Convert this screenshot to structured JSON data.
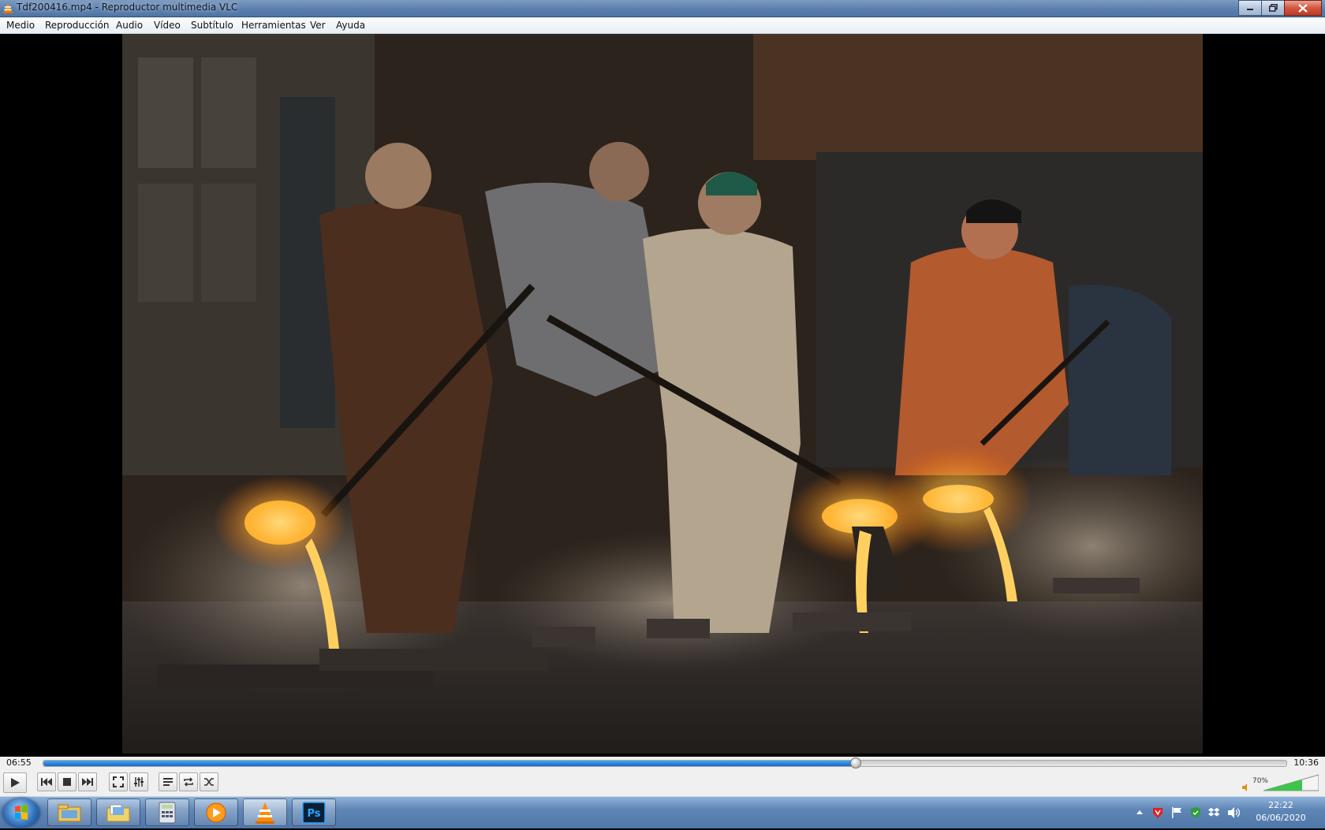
{
  "window": {
    "title": "Tdf200416.mp4 - Reproductor multimedia VLC",
    "icon": "vlc-cone-icon"
  },
  "menu": [
    "Medio",
    "Reproducción",
    "Audio",
    "Vídeo",
    "Subtítulo",
    "Herramientas",
    "Ver",
    "Ayuda"
  ],
  "playback": {
    "elapsed": "06:55",
    "total": "10:36",
    "progress_fraction": 0.653
  },
  "controls": {
    "buttons": [
      "play-icon",
      "previous-icon",
      "stop-icon",
      "next-icon",
      "fullscreen-icon",
      "extended-settings-icon",
      "playlist-icon",
      "loop-icon",
      "shuffle-icon"
    ],
    "volume_label": "70%",
    "volume_fraction": 0.7
  },
  "taskbar": {
    "apps": [
      "windows-explorer-icon",
      "folder-icon",
      "calculator-icon",
      "media-player-icon",
      "vlc-icon",
      "photoshop-icon"
    ],
    "photoshop_label": "Ps",
    "clock_time": "22:22",
    "clock_date": "06/06/2020"
  },
  "colors": {
    "seek_fill": "#1e7ad6",
    "molten_metal": "#ffb030",
    "volume_green": "#3ec44a"
  }
}
